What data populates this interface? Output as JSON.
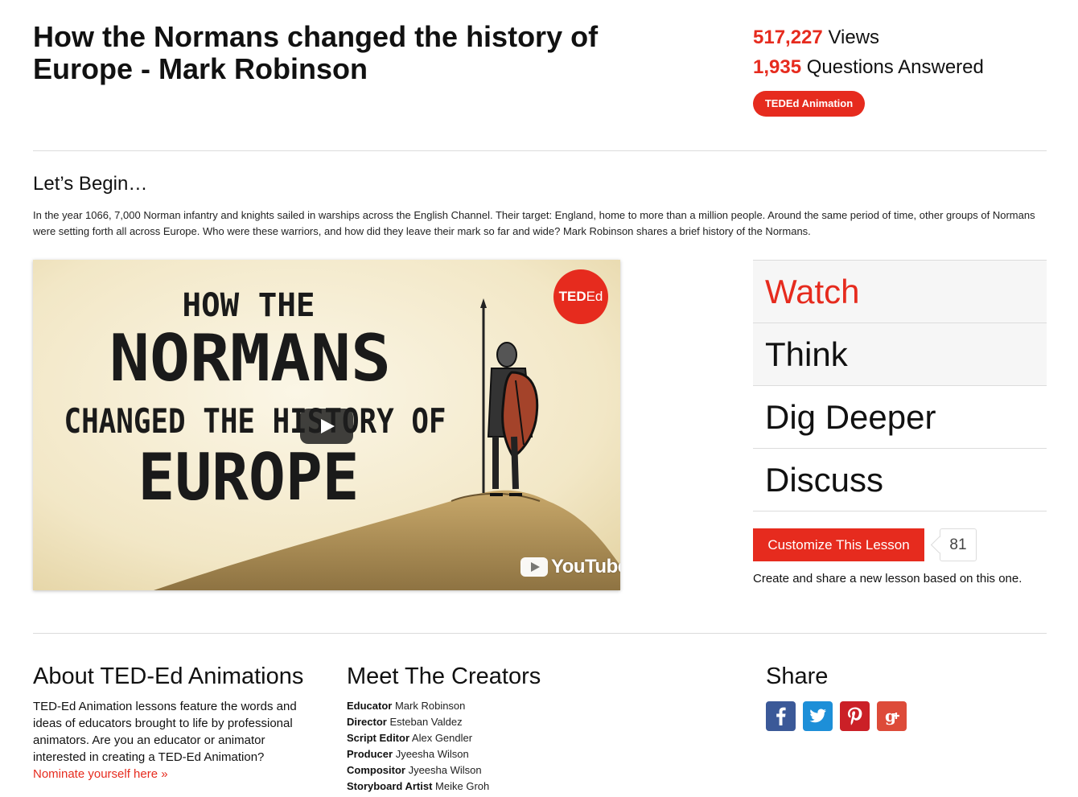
{
  "lesson": {
    "title": "How the Normans changed the history of Europe - Mark Robinson",
    "views_count": "517,227",
    "views_label": "Views",
    "questions_count": "1,935",
    "questions_label": "Questions Answered",
    "badge_bold": "TEDEd",
    "badge_light": "Animation"
  },
  "begin": {
    "heading": "Let’s Begin…",
    "description": "In the year 1066, 7,000 Norman infantry and knights sailed in warships across the English Channel. Their target: England, home to more than a million people. Around the same period of time, other groups of Normans were setting forth all across Europe. Who were these warriors, and how did they leave their mark so far and wide? Mark Robinson shares a brief history of the Normans."
  },
  "video": {
    "lines": [
      "HOW THE",
      "NORMANS",
      "CHANGED THE HISTORY OF",
      "EUROPE"
    ],
    "logo_bold": "TED",
    "logo_light": "Ed",
    "youtube_label": "YouTube",
    "icon": "play-icon"
  },
  "tabs": {
    "watch": "Watch",
    "think": "Think",
    "dig": "Dig Deeper",
    "discuss": "Discuss"
  },
  "customize": {
    "button": "Customize This Lesson",
    "count": "81",
    "note": "Create and share a new lesson based on this one."
  },
  "about": {
    "heading": "About TED-Ed Animations",
    "text": "TED-Ed Animation lessons feature the words and ideas of educators brought to life by professional animators. Are you an educator or animator interested in creating a TED-Ed Animation?",
    "link": "Nominate yourself here »"
  },
  "creators": {
    "heading": "Meet The Creators",
    "list": [
      {
        "role": "Educator",
        "name": "Mark Robinson"
      },
      {
        "role": "Director",
        "name": "Esteban Valdez"
      },
      {
        "role": "Script Editor",
        "name": "Alex Gendler"
      },
      {
        "role": "Producer",
        "name": "Jyeesha Wilson"
      },
      {
        "role": "Compositor",
        "name": "Jyeesha Wilson"
      },
      {
        "role": "Storyboard Artist",
        "name": "Meike Groh"
      }
    ]
  },
  "share": {
    "heading": "Share",
    "buttons": [
      {
        "icon": "facebook-icon",
        "color": "#3b5998"
      },
      {
        "icon": "twitter-icon",
        "color": "#1d8fd8"
      },
      {
        "icon": "pinterest-icon",
        "color": "#cb2027"
      },
      {
        "icon": "google-plus-icon",
        "color": "#dd4b39"
      }
    ]
  },
  "colors": {
    "accent": "#e62b1e",
    "divider": "#dcdcdc",
    "tab_bg": "#f6f6f6"
  }
}
